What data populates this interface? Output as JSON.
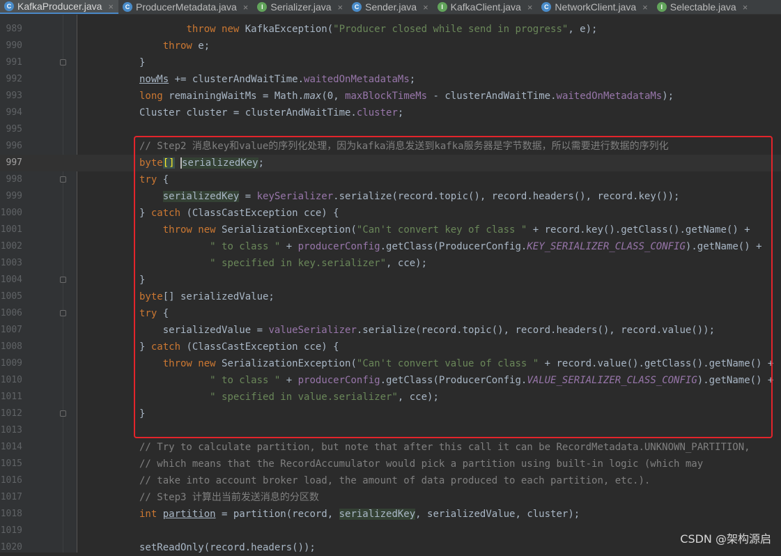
{
  "tabs": [
    {
      "label": "KafkaProducer.java",
      "icon": "class-icon",
      "icon_letter": "C",
      "active": true
    },
    {
      "label": "ProducerMetadata.java",
      "icon": "class-icon",
      "icon_letter": "C",
      "active": false
    },
    {
      "label": "Serializer.java",
      "icon": "interface-icon",
      "icon_letter": "I",
      "active": false
    },
    {
      "label": "Sender.java",
      "icon": "class-icon",
      "icon_letter": "C",
      "active": false
    },
    {
      "label": "KafkaClient.java",
      "icon": "interface-icon",
      "icon_letter": "I",
      "active": false
    },
    {
      "label": "NetworkClient.java",
      "icon": "class-icon",
      "icon_letter": "C",
      "active": false
    },
    {
      "label": "Selectable.java",
      "icon": "interface-icon",
      "icon_letter": "I",
      "active": false
    }
  ],
  "tab_close_glyph": "×",
  "colors": {
    "background": "#2b2b2b",
    "keyword": "#cc7832",
    "string": "#6a8759",
    "field": "#9876aa",
    "comment": "#808080",
    "plain": "#a9b7c6",
    "highlight_box": "#e3242b"
  },
  "current_line": 997,
  "code_lines": [
    {
      "num": "989",
      "segments": [
        [
          "",
          "        "
        ],
        [
          "kw",
          "throw new "
        ],
        [
          "",
          "KafkaException("
        ],
        [
          "str",
          "\"Producer closed while send in progress\""
        ],
        [
          "",
          ", e);"
        ]
      ]
    },
    {
      "num": "990",
      "segments": [
        [
          "",
          "    "
        ],
        [
          "kw",
          "throw "
        ],
        [
          "",
          "e;"
        ]
      ]
    },
    {
      "num": "991",
      "fold": true,
      "segments": [
        [
          "",
          "}"
        ]
      ]
    },
    {
      "num": "992",
      "segments": [
        [
          "ul",
          "nowMs"
        ],
        [
          "",
          " += clusterAndWaitTime."
        ],
        [
          "fld",
          "waitedOnMetadataMs"
        ],
        [
          "",
          ";"
        ]
      ]
    },
    {
      "num": "993",
      "segments": [
        [
          "kw",
          "long "
        ],
        [
          "",
          "remainingWaitMs = Math."
        ],
        [
          "st",
          "max"
        ],
        [
          "",
          "("
        ],
        [
          "num",
          "0"
        ],
        [
          "",
          ", "
        ],
        [
          "fld",
          "maxBlockTimeMs"
        ],
        [
          "",
          " - clusterAndWaitTime."
        ],
        [
          "fld",
          "waitedOnMetadataMs"
        ],
        [
          "",
          ");"
        ]
      ]
    },
    {
      "num": "994",
      "segments": [
        [
          "",
          "Cluster cluster = clusterAndWaitTime."
        ],
        [
          "fld",
          "cluster"
        ],
        [
          "",
          ";"
        ]
      ]
    },
    {
      "num": "995",
      "segments": []
    },
    {
      "num": "996",
      "segments": [
        [
          "cmt",
          "// Step2 消息key和value的序列化处理，因为kafka消息发送到kafka服务器是字节数据，所以需要进行数据的序列化"
        ]
      ]
    },
    {
      "num": "997",
      "segments": [
        [
          "kw",
          "byte"
        ],
        [
          "brk",
          "[]"
        ],
        [
          "",
          " "
        ],
        [
          "caret",
          ""
        ],
        [
          "hl",
          "serializedKey"
        ],
        [
          "",
          ";"
        ]
      ]
    },
    {
      "num": "998",
      "fold": true,
      "segments": [
        [
          "kw",
          "try "
        ],
        [
          "",
          "{"
        ]
      ]
    },
    {
      "num": "999",
      "segments": [
        [
          "",
          "    "
        ],
        [
          "hl",
          "serializedKey"
        ],
        [
          "",
          " = "
        ],
        [
          "fld",
          "keySerializer"
        ],
        [
          "",
          ".serialize(record.topic(), record.headers(), record.key());"
        ]
      ]
    },
    {
      "num": "1000",
      "segments": [
        [
          "",
          "} "
        ],
        [
          "kw",
          "catch "
        ],
        [
          "",
          "(ClassCastException cce) {"
        ]
      ]
    },
    {
      "num": "1001",
      "segments": [
        [
          "",
          "    "
        ],
        [
          "kw",
          "throw new "
        ],
        [
          "",
          "SerializationException("
        ],
        [
          "str",
          "\"Can't convert key of class \""
        ],
        [
          "",
          " + record.key().getClass().getName() +"
        ]
      ]
    },
    {
      "num": "1002",
      "segments": [
        [
          "",
          "            "
        ],
        [
          "str",
          "\" to class \""
        ],
        [
          "",
          " + "
        ],
        [
          "fld",
          "producerConfig"
        ],
        [
          "",
          ".getClass(ProducerConfig."
        ],
        [
          "cst",
          "KEY_SERIALIZER_CLASS_CONFIG"
        ],
        [
          "",
          ").getName() +"
        ]
      ]
    },
    {
      "num": "1003",
      "segments": [
        [
          "",
          "            "
        ],
        [
          "str",
          "\" specified in key.serializer\""
        ],
        [
          "",
          ", cce);"
        ]
      ]
    },
    {
      "num": "1004",
      "fold": true,
      "segments": [
        [
          "",
          "}"
        ]
      ]
    },
    {
      "num": "1005",
      "segments": [
        [
          "kw",
          "byte"
        ],
        [
          "",
          "[] serializedValue;"
        ]
      ]
    },
    {
      "num": "1006",
      "fold": true,
      "segments": [
        [
          "kw",
          "try "
        ],
        [
          "",
          "{"
        ]
      ]
    },
    {
      "num": "1007",
      "segments": [
        [
          "",
          "    serializedValue = "
        ],
        [
          "fld",
          "valueSerializer"
        ],
        [
          "",
          ".serialize(record.topic(), record.headers(), record.value());"
        ]
      ]
    },
    {
      "num": "1008",
      "segments": [
        [
          "",
          "} "
        ],
        [
          "kw",
          "catch "
        ],
        [
          "",
          "(ClassCastException cce) {"
        ]
      ]
    },
    {
      "num": "1009",
      "segments": [
        [
          "",
          "    "
        ],
        [
          "kw",
          "throw new "
        ],
        [
          "",
          "SerializationException("
        ],
        [
          "str",
          "\"Can't convert value of class \""
        ],
        [
          "",
          " + record.value().getClass().getName() +"
        ]
      ]
    },
    {
      "num": "1010",
      "segments": [
        [
          "",
          "            "
        ],
        [
          "str",
          "\" to class \""
        ],
        [
          "",
          " + "
        ],
        [
          "fld",
          "producerConfig"
        ],
        [
          "",
          ".getClass(ProducerConfig."
        ],
        [
          "cst",
          "VALUE_SERIALIZER_CLASS_CONFIG"
        ],
        [
          "",
          ").getName() +"
        ]
      ]
    },
    {
      "num": "1011",
      "segments": [
        [
          "",
          "            "
        ],
        [
          "str",
          "\" specified in value.serializer\""
        ],
        [
          "",
          ", cce);"
        ]
      ]
    },
    {
      "num": "1012",
      "fold": true,
      "segments": [
        [
          "",
          "}"
        ]
      ]
    },
    {
      "num": "1013",
      "segments": []
    },
    {
      "num": "1014",
      "segments": [
        [
          "cmt",
          "// Try to calculate partition, but note that after this call it can be RecordMetadata.UNKNOWN_PARTITION,"
        ]
      ]
    },
    {
      "num": "1015",
      "segments": [
        [
          "cmt",
          "// which means that the RecordAccumulator would pick a partition using built-in logic (which may"
        ]
      ]
    },
    {
      "num": "1016",
      "segments": [
        [
          "cmt",
          "// take into account broker load, the amount of data produced to each partition, etc.)."
        ]
      ]
    },
    {
      "num": "1017",
      "segments": [
        [
          "cmt",
          "// Step3 计算出当前发送消息的分区数"
        ]
      ]
    },
    {
      "num": "1018",
      "segments": [
        [
          "kw",
          "int "
        ],
        [
          "ul",
          "partition"
        ],
        [
          "",
          " = partition(record, "
        ],
        [
          "hl",
          "serializedKey"
        ],
        [
          "",
          ", serializedValue, cluster);"
        ]
      ]
    },
    {
      "num": "1019",
      "segments": []
    },
    {
      "num": "1020",
      "segments": [
        [
          "",
          "setReadOnly(record.headers());"
        ]
      ]
    }
  ],
  "watermark": "CSDN @架构源启"
}
